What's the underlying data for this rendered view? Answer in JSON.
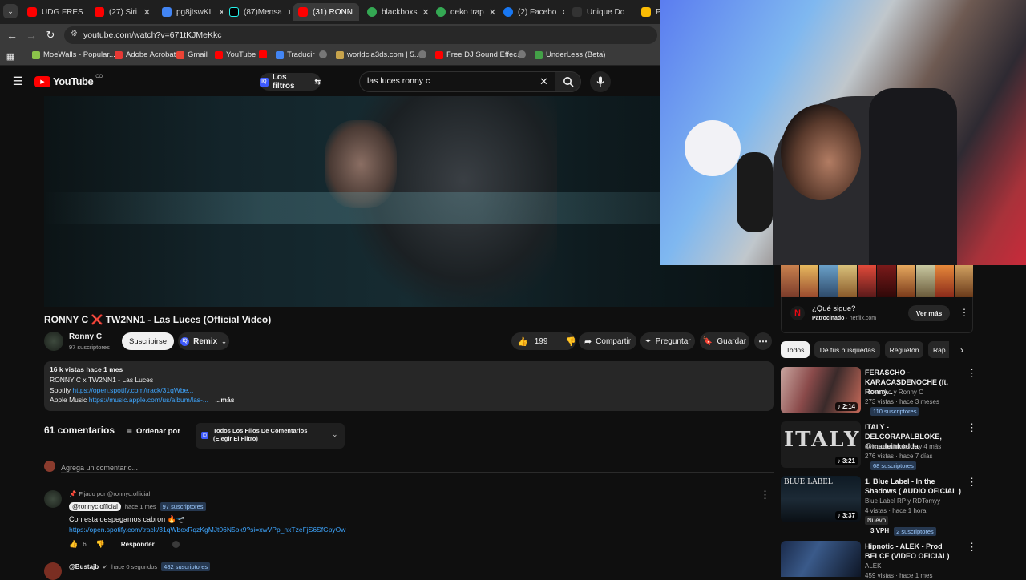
{
  "browser": {
    "tabs": [
      {
        "label": "UDG FRES",
        "color": "#ff0000"
      },
      {
        "label": "(27) Siri",
        "color": "#ff0000"
      },
      {
        "label": "pg8jtswKL",
        "color": "#4285f4"
      },
      {
        "label": "(87)Mensa",
        "color": "#25f4ee"
      },
      {
        "label": "(31) RONN",
        "color": "#ff0000",
        "active": true
      },
      {
        "label": "blackboxs",
        "color": "#34a853"
      },
      {
        "label": "deko trap",
        "color": "#34a853"
      },
      {
        "label": "(2) Facebo",
        "color": "#1877f2"
      },
      {
        "label": "Unique Do",
        "color": "#333333"
      },
      {
        "label": "PA",
        "color": "#fbbc04"
      }
    ],
    "url": "youtube.com/watch?v=671tKJMeKkc",
    "bookmarks": [
      {
        "label": "MoeWalls - Popular...",
        "color": "#8bc34a"
      },
      {
        "label": "Adobe Acrobat",
        "color": "#e53935"
      },
      {
        "label": "Gmail",
        "color": "#ea4335"
      },
      {
        "label": "YouTube",
        "color": "#ff0000"
      },
      {
        "label": "",
        "color": "#ff0000"
      },
      {
        "label": "Traducir",
        "color": "#4285f4"
      },
      {
        "label": "",
        "color": "#777777"
      },
      {
        "label": "worldcia3ds.com | 5...",
        "color": "#c7a34b"
      },
      {
        "label": "",
        "color": "#777777"
      },
      {
        "label": "Free DJ Sound Effec...",
        "color": "#ff0000"
      },
      {
        "label": "",
        "color": "#777777"
      },
      {
        "label": "UnderLess (Beta)",
        "color": "#43a047"
      }
    ]
  },
  "yt": {
    "logo": "YouTube",
    "country": "CO",
    "filters_label": "Los filtros",
    "search_value": "las luces ronny c"
  },
  "video": {
    "title": "RONNY C ❌ TW2NN1 - Las Luces (Official Video)",
    "channel": "Ronny C",
    "subscribers": "97 suscriptores",
    "subscribe_label": "Suscribirse",
    "remix_label": "Remix",
    "likes": "199",
    "share_label": "Compartir",
    "ask_label": "Preguntar",
    "save_label": "Guardar",
    "desc_stats": "16 k vistas  hace 1 mes",
    "desc_line1": "RONNY C x TW2NN1 - Las Luces",
    "spotify_label": "Spotify",
    "spotify_link": "https://open.spotify.com/track/31qWbe...",
    "apple_label": "Apple Music",
    "apple_link": "https://music.apple.com/us/album/las-...",
    "more_label": "...más"
  },
  "comments": {
    "count": "61 comentarios",
    "sort_label": "Ordenar por",
    "filter_label": "Todos Los Hilos De Comentarios (Elegir El Filtro)",
    "add_placeholder": "Agrega un comentario...",
    "items": [
      {
        "pinned": "Fijado por @ronnyc.official",
        "author": "@ronnyc.official",
        "time": "hace 1 mes",
        "subs": "97 suscriptores",
        "text": "Con esta despegamos cabron 🔥🛫",
        "link": "https://open.spotify.com/track/31qWbexRqzKgMJt06N5ok9?si=xwVPp_nxTzeFjS6SfGpyOw",
        "likes": "6",
        "reply": "Responder"
      },
      {
        "author": "@Bustajb",
        "time": "hace 0 segundos",
        "subs": "482 suscriptores"
      }
    ]
  },
  "sidebar": {
    "ad": {
      "title": "¿Qué sigue?",
      "sponsor": "Patrocinado",
      "domain": "netflix.com",
      "cta": "Ver más"
    },
    "chips": [
      "Todos",
      "De tus búsquedas",
      "Reguetón",
      "Rap"
    ],
    "videos": [
      {
        "title": "FERASCHO - KARACASDENOCHE (ft. Ronny...",
        "channel": "Ferascho y Ronny C",
        "stats": "273 vistas · hace 3 meses",
        "subs": "110 suscriptores",
        "duration": "2:14"
      },
      {
        "title": "ITALY - DELCORAPALBLOKE, @madeinkodda",
        "channel": "delcorapalbloke ✓ y 4 más",
        "stats": "276 vistas · hace 7 días",
        "subs": "68 suscriptores",
        "duration": "3:21"
      },
      {
        "title": "1. Blue Label - In the Shadows ( AUDIO OFICIAL )",
        "channel": "Blue Label RP y RDTomyy",
        "stats": "4 vistas · hace 1 hora",
        "badge": "Nuevo",
        "vph": "3 VPH",
        "subs": "2 suscriptores",
        "duration": "3:37",
        "thumb_text": "BLUE LABEL"
      },
      {
        "title": "Hipnotic - ALEK - Prod BELCE (VIDEO OFICIAL)",
        "channel": "ALEK",
        "stats": "459 vistas · hace 1 mes"
      }
    ]
  }
}
